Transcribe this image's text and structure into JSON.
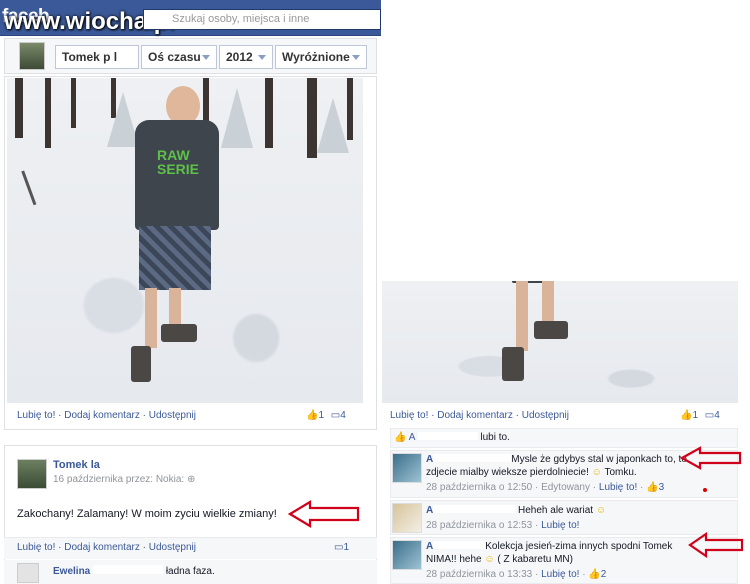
{
  "top_bar": {
    "logo_text": "faceb",
    "watermark": "www.wiocha.pl",
    "search_placeholder": "Szukaj osoby, miejsca i inne"
  },
  "filter_bar": {
    "name": "Tomek   p   l",
    "timeline": "Oś czasu",
    "year": "2012",
    "highlights": "Wyróżnione"
  },
  "post1": {
    "like": "Lubię to!",
    "comment": "Dodaj komentarz",
    "share": "Udostępnij",
    "likes_count": "1",
    "comments_count": "4"
  },
  "post2": {
    "author": "Tomek        la",
    "meta": "16 października przez: Nokia:",
    "text": "Zakochany! Zalamany! W moim zyciu wielkie zmiany!",
    "like": "Lubię to!",
    "comment": "Dodaj komentarz",
    "share": "Udostępnij",
    "comments_count": "1",
    "commenter": "Ewelina",
    "comment_tail": "ładna faza."
  },
  "right": {
    "like": "Lubię to!",
    "comment": "Dodaj komentarz",
    "share": "Udostępnij",
    "likes_count": "1",
    "comments_count": "4",
    "likes_line_name": "A",
    "likes_line_suffix": "lubi to.",
    "comments": [
      {
        "author": "A",
        "text_a": "Mysle że gdybys stal w japonkach to, to",
        "text_b": "zdjecie mialby wieksze pierdolniecie!",
        "text_c": "Tomku.",
        "date": "28 października o 12:50",
        "edited": "Edytowany",
        "like": "Lubię to!",
        "likes": "3"
      },
      {
        "author": "A",
        "text_a": "Heheh ale wariat",
        "date": "28 października o 12:53",
        "like": "Lubię to!"
      },
      {
        "author": "A",
        "text_a": "Kolekcja jesień-zima innych spodni Tomek",
        "text_b": "NIMA!! hehe",
        "text_c": "( Z kabaretu MN)",
        "date": "28 października o 13:33",
        "like": "Lubię to!",
        "likes": "2"
      }
    ]
  },
  "colors": {
    "brand": "#3b5998",
    "arrow": "#d0021b",
    "link": "#3b5998",
    "meta": "#90949c"
  }
}
